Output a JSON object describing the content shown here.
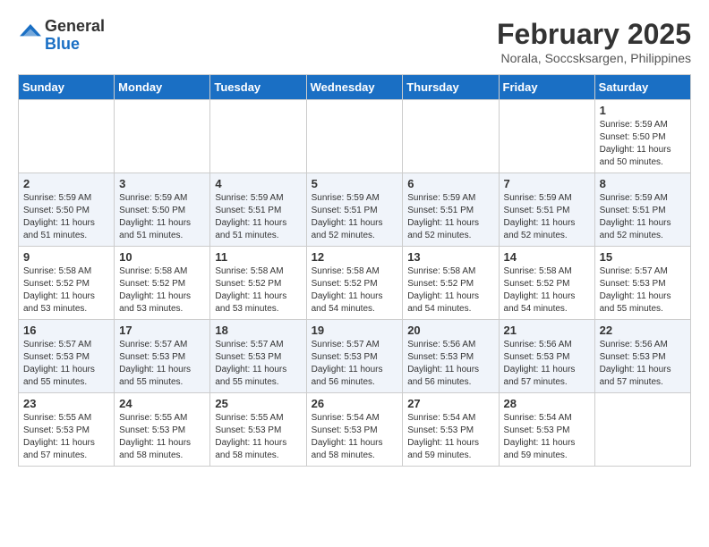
{
  "logo": {
    "general": "General",
    "blue": "Blue"
  },
  "title": "February 2025",
  "subtitle": "Norala, Soccsksargen, Philippines",
  "days_of_week": [
    "Sunday",
    "Monday",
    "Tuesday",
    "Wednesday",
    "Thursday",
    "Friday",
    "Saturday"
  ],
  "weeks": [
    {
      "days": [
        {
          "num": "",
          "info": ""
        },
        {
          "num": "",
          "info": ""
        },
        {
          "num": "",
          "info": ""
        },
        {
          "num": "",
          "info": ""
        },
        {
          "num": "",
          "info": ""
        },
        {
          "num": "",
          "info": ""
        },
        {
          "num": "1",
          "info": "Sunrise: 5:59 AM\nSunset: 5:50 PM\nDaylight: 11 hours\nand 50 minutes."
        }
      ]
    },
    {
      "days": [
        {
          "num": "2",
          "info": "Sunrise: 5:59 AM\nSunset: 5:50 PM\nDaylight: 11 hours\nand 51 minutes."
        },
        {
          "num": "3",
          "info": "Sunrise: 5:59 AM\nSunset: 5:50 PM\nDaylight: 11 hours\nand 51 minutes."
        },
        {
          "num": "4",
          "info": "Sunrise: 5:59 AM\nSunset: 5:51 PM\nDaylight: 11 hours\nand 51 minutes."
        },
        {
          "num": "5",
          "info": "Sunrise: 5:59 AM\nSunset: 5:51 PM\nDaylight: 11 hours\nand 52 minutes."
        },
        {
          "num": "6",
          "info": "Sunrise: 5:59 AM\nSunset: 5:51 PM\nDaylight: 11 hours\nand 52 minutes."
        },
        {
          "num": "7",
          "info": "Sunrise: 5:59 AM\nSunset: 5:51 PM\nDaylight: 11 hours\nand 52 minutes."
        },
        {
          "num": "8",
          "info": "Sunrise: 5:59 AM\nSunset: 5:51 PM\nDaylight: 11 hours\nand 52 minutes."
        }
      ]
    },
    {
      "days": [
        {
          "num": "9",
          "info": "Sunrise: 5:58 AM\nSunset: 5:52 PM\nDaylight: 11 hours\nand 53 minutes."
        },
        {
          "num": "10",
          "info": "Sunrise: 5:58 AM\nSunset: 5:52 PM\nDaylight: 11 hours\nand 53 minutes."
        },
        {
          "num": "11",
          "info": "Sunrise: 5:58 AM\nSunset: 5:52 PM\nDaylight: 11 hours\nand 53 minutes."
        },
        {
          "num": "12",
          "info": "Sunrise: 5:58 AM\nSunset: 5:52 PM\nDaylight: 11 hours\nand 54 minutes."
        },
        {
          "num": "13",
          "info": "Sunrise: 5:58 AM\nSunset: 5:52 PM\nDaylight: 11 hours\nand 54 minutes."
        },
        {
          "num": "14",
          "info": "Sunrise: 5:58 AM\nSunset: 5:52 PM\nDaylight: 11 hours\nand 54 minutes."
        },
        {
          "num": "15",
          "info": "Sunrise: 5:57 AM\nSunset: 5:53 PM\nDaylight: 11 hours\nand 55 minutes."
        }
      ]
    },
    {
      "days": [
        {
          "num": "16",
          "info": "Sunrise: 5:57 AM\nSunset: 5:53 PM\nDaylight: 11 hours\nand 55 minutes."
        },
        {
          "num": "17",
          "info": "Sunrise: 5:57 AM\nSunset: 5:53 PM\nDaylight: 11 hours\nand 55 minutes."
        },
        {
          "num": "18",
          "info": "Sunrise: 5:57 AM\nSunset: 5:53 PM\nDaylight: 11 hours\nand 55 minutes."
        },
        {
          "num": "19",
          "info": "Sunrise: 5:57 AM\nSunset: 5:53 PM\nDaylight: 11 hours\nand 56 minutes."
        },
        {
          "num": "20",
          "info": "Sunrise: 5:56 AM\nSunset: 5:53 PM\nDaylight: 11 hours\nand 56 minutes."
        },
        {
          "num": "21",
          "info": "Sunrise: 5:56 AM\nSunset: 5:53 PM\nDaylight: 11 hours\nand 57 minutes."
        },
        {
          "num": "22",
          "info": "Sunrise: 5:56 AM\nSunset: 5:53 PM\nDaylight: 11 hours\nand 57 minutes."
        }
      ]
    },
    {
      "days": [
        {
          "num": "23",
          "info": "Sunrise: 5:55 AM\nSunset: 5:53 PM\nDaylight: 11 hours\nand 57 minutes."
        },
        {
          "num": "24",
          "info": "Sunrise: 5:55 AM\nSunset: 5:53 PM\nDaylight: 11 hours\nand 58 minutes."
        },
        {
          "num": "25",
          "info": "Sunrise: 5:55 AM\nSunset: 5:53 PM\nDaylight: 11 hours\nand 58 minutes."
        },
        {
          "num": "26",
          "info": "Sunrise: 5:54 AM\nSunset: 5:53 PM\nDaylight: 11 hours\nand 58 minutes."
        },
        {
          "num": "27",
          "info": "Sunrise: 5:54 AM\nSunset: 5:53 PM\nDaylight: 11 hours\nand 59 minutes."
        },
        {
          "num": "28",
          "info": "Sunrise: 5:54 AM\nSunset: 5:53 PM\nDaylight: 11 hours\nand 59 minutes."
        },
        {
          "num": "",
          "info": ""
        }
      ]
    }
  ]
}
